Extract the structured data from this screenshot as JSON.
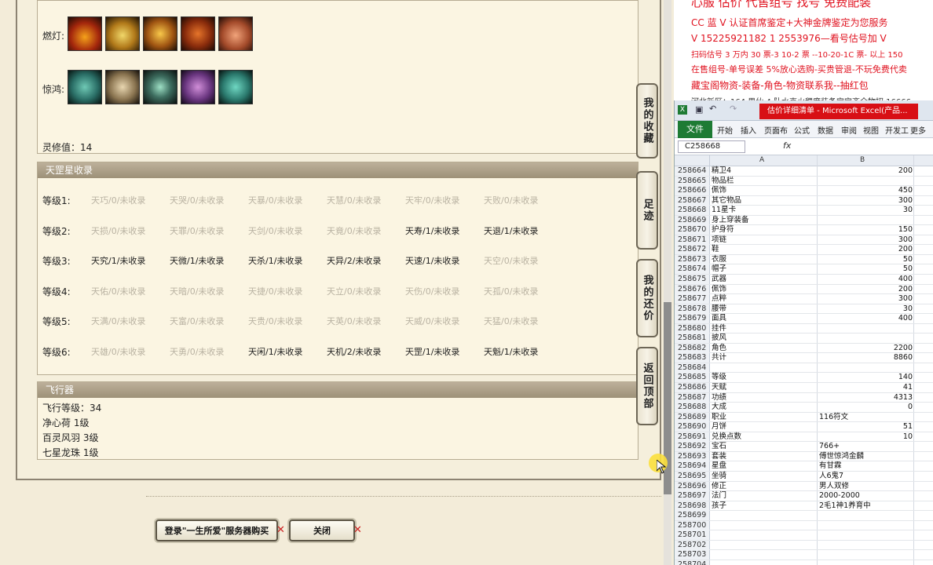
{
  "game": {
    "lamp_label": "燃灯:",
    "jinghong_label": "惊鸿:",
    "lingxiu": "灵修值：14",
    "tiangang": {
      "title": "天罡星收录",
      "rows": [
        {
          "label": "等级1:",
          "cells": [
            {
              "t": "天巧/0/未收录",
              "on": false
            },
            {
              "t": "天哭/0/未收录",
              "on": false
            },
            {
              "t": "天暴/0/未收录",
              "on": false
            },
            {
              "t": "天慧/0/未收录",
              "on": false
            },
            {
              "t": "天牢/0/未收录",
              "on": false
            },
            {
              "t": "天败/0/未收录",
              "on": false
            }
          ]
        },
        {
          "label": "等级2:",
          "cells": [
            {
              "t": "天损/0/未收录",
              "on": false
            },
            {
              "t": "天罪/0/未收录",
              "on": false
            },
            {
              "t": "天剑/0/未收录",
              "on": false
            },
            {
              "t": "天竟/0/未收录",
              "on": false
            },
            {
              "t": "天寿/1/未收录",
              "on": true
            },
            {
              "t": "天退/1/未收录",
              "on": true
            }
          ]
        },
        {
          "label": "等级3:",
          "cells": [
            {
              "t": "天究/1/未收录",
              "on": true
            },
            {
              "t": "天微/1/未收录",
              "on": true
            },
            {
              "t": "天杀/1/未收录",
              "on": true
            },
            {
              "t": "天异/2/未收录",
              "on": true
            },
            {
              "t": "天速/1/未收录",
              "on": true
            },
            {
              "t": "天空/0/未收录",
              "on": false
            }
          ]
        },
        {
          "label": "等级4:",
          "cells": [
            {
              "t": "天佑/0/未收录",
              "on": false
            },
            {
              "t": "天暗/0/未收录",
              "on": false
            },
            {
              "t": "天捷/0/未收录",
              "on": false
            },
            {
              "t": "天立/0/未收录",
              "on": false
            },
            {
              "t": "天伤/0/未收录",
              "on": false
            },
            {
              "t": "天孤/0/未收录",
              "on": false
            }
          ]
        },
        {
          "label": "等级5:",
          "cells": [
            {
              "t": "天满/0/未收录",
              "on": false
            },
            {
              "t": "天富/0/未收录",
              "on": false
            },
            {
              "t": "天贵/0/未收录",
              "on": false
            },
            {
              "t": "天英/0/未收录",
              "on": false
            },
            {
              "t": "天威/0/未收录",
              "on": false
            },
            {
              "t": "天猛/0/未收录",
              "on": false
            }
          ]
        },
        {
          "label": "等级6:",
          "cells": [
            {
              "t": "天雄/0/未收录",
              "on": false
            },
            {
              "t": "天勇/0/未收录",
              "on": false
            },
            {
              "t": "天闲/1/未收录",
              "on": true
            },
            {
              "t": "天机/2/未收录",
              "on": true
            },
            {
              "t": "天罡/1/未收录",
              "on": true
            },
            {
              "t": "天魁/1/未收录",
              "on": true
            }
          ]
        }
      ]
    },
    "flyer": {
      "title": "飞行器",
      "lines": [
        "飞行等级：34",
        "净心荷   1级",
        "百灵风羽   3级",
        "七星龙珠   1级"
      ]
    },
    "side_tabs": [
      "我的收藏",
      "足迹",
      "我的还价",
      "返回顶部"
    ],
    "buttons": {
      "login": "登录\"一生所爱\"服务器购买",
      "close": "关闭"
    }
  },
  "ads": [
    "CC 蓝 V 认证首席鉴定+大神金牌鉴定为您服务",
    "V 15225921182      1  2553976—看号估号加 V",
    "扫码估号 3 万内 30 票-3 10-2  票 --10-20-1C 票-  以上 150",
    "在售组号-单号误差 5%放心选购-买贵管退-不玩免费代卖",
    "藏宝阁物资-装备-角色-物资联系我--抽红包",
    "河北新区：164 男仙 4 队水克火稞度装备宝宝齐全物招 16666"
  ],
  "excel": {
    "window_title": "估价详细清单 - Microsoft Excel(产品...",
    "file_tab": "文件",
    "ribbon_tabs": [
      "开始",
      "插入",
      "页面布",
      "公式",
      "数据",
      "审阅",
      "视图",
      "开发工",
      "更多"
    ],
    "name_box": "C258668",
    "fx": "fx",
    "col_a": "A",
    "col_b": "B",
    "rows": [
      {
        "n": "258664",
        "a": "精卫4",
        "b": "200",
        "num": true
      },
      {
        "n": "258665",
        "a": "物品栏",
        "b": "",
        "num": true
      },
      {
        "n": "258666",
        "a": "佩饰",
        "b": "450",
        "num": true
      },
      {
        "n": "258667",
        "a": "其它物品",
        "b": "300",
        "num": true
      },
      {
        "n": "258668",
        "a": "11星卡",
        "b": "30",
        "num": true
      },
      {
        "n": "258669",
        "a": "身上穿装备",
        "b": "",
        "num": true
      },
      {
        "n": "258670",
        "a": "护身符",
        "b": "150",
        "num": true
      },
      {
        "n": "258671",
        "a": "项链",
        "b": "300",
        "num": true
      },
      {
        "n": "258672",
        "a": "鞋",
        "b": "200",
        "num": true
      },
      {
        "n": "258673",
        "a": "衣服",
        "b": "50",
        "num": true
      },
      {
        "n": "258674",
        "a": "帽子",
        "b": "50",
        "num": true
      },
      {
        "n": "258675",
        "a": "武器",
        "b": "400",
        "num": true
      },
      {
        "n": "258676",
        "a": "佩饰",
        "b": "200",
        "num": true
      },
      {
        "n": "258677",
        "a": "点粹",
        "b": "300",
        "num": true
      },
      {
        "n": "258678",
        "a": "腰带",
        "b": "30",
        "num": true
      },
      {
        "n": "258679",
        "a": "面具",
        "b": "400",
        "num": true
      },
      {
        "n": "258680",
        "a": "挂件",
        "b": "",
        "num": true
      },
      {
        "n": "258681",
        "a": "披风",
        "b": "",
        "num": true
      },
      {
        "n": "258682",
        "a": "角色",
        "b": "2200",
        "num": true
      },
      {
        "n": "258683",
        "a": "共计",
        "b": "8860",
        "num": true
      },
      {
        "n": "258684",
        "a": "",
        "b": "",
        "num": true
      },
      {
        "n": "258685",
        "a": "等级",
        "b": "140",
        "num": true
      },
      {
        "n": "258686",
        "a": "天赋",
        "b": "41",
        "num": true
      },
      {
        "n": "258687",
        "a": "功绩",
        "b": "4313",
        "num": true
      },
      {
        "n": "258688",
        "a": "大成",
        "b": "0",
        "num": true
      },
      {
        "n": "258689",
        "a": "职业",
        "b": "116符文",
        "num": false
      },
      {
        "n": "258690",
        "a": "月饼",
        "b": "51",
        "num": true
      },
      {
        "n": "258691",
        "a": "兑换点数",
        "b": "10",
        "num": true
      },
      {
        "n": "258692",
        "a": "宝石",
        "b": "766+",
        "num": false
      },
      {
        "n": "258693",
        "a": "套装",
        "b": "傅世惊鸿金麟",
        "num": false
      },
      {
        "n": "258694",
        "a": "星盘",
        "b": "有甘霖",
        "num": false
      },
      {
        "n": "258695",
        "a": "坐骑",
        "b": "人6鬼7",
        "num": false
      },
      {
        "n": "258696",
        "a": "修正",
        "b": "男人双修",
        "num": false
      },
      {
        "n": "258697",
        "a": "法门",
        "b": "2000-2000",
        "num": false
      },
      {
        "n": "258698",
        "a": "孩子",
        "b": "2毛1神1养育中",
        "num": false
      },
      {
        "n": "258699",
        "a": "",
        "b": "",
        "num": true
      },
      {
        "n": "258700",
        "a": "",
        "b": "",
        "num": true
      },
      {
        "n": "258701",
        "a": "",
        "b": "",
        "num": true
      },
      {
        "n": "258702",
        "a": "",
        "b": "",
        "num": true
      },
      {
        "n": "258703",
        "a": "",
        "b": "",
        "num": true
      },
      {
        "n": "258704",
        "a": "",
        "b": "",
        "num": true
      }
    ]
  }
}
